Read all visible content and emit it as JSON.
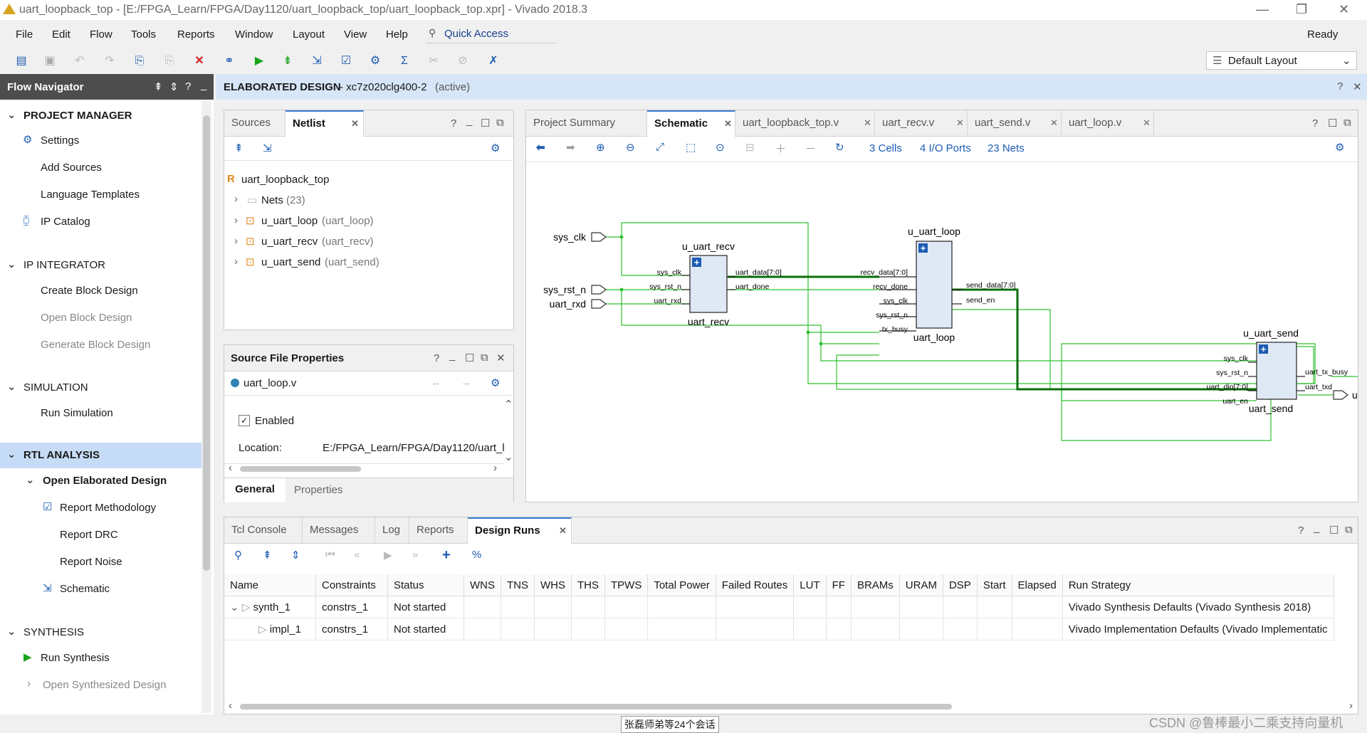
{
  "window": {
    "title": "uart_loopback_top - [E:/FPGA_Learn/FPGA/Day1120/uart_loopback_top/uart_loopback_top.xpr] - Vivado 2018.3",
    "minimize": "—",
    "restore": "❐",
    "close": "✕"
  },
  "menu": {
    "items": [
      "File",
      "Edit",
      "Flow",
      "Tools",
      "Reports",
      "Window",
      "Layout",
      "View",
      "Help"
    ],
    "quick_access": "Quick Access",
    "status": "Ready",
    "layout_select": "Default Layout"
  },
  "flow_nav": {
    "title": "Flow Navigator",
    "sections": [
      {
        "title": "PROJECT MANAGER",
        "items": [
          "Settings",
          "Add Sources",
          "Language Templates",
          "IP Catalog"
        ]
      },
      {
        "title": "IP INTEGRATOR",
        "items": [
          "Create Block Design",
          "Open Block Design",
          "Generate Block Design"
        ]
      },
      {
        "title": "SIMULATION",
        "items": [
          "Run Simulation"
        ]
      },
      {
        "title": "RTL ANALYSIS",
        "items": [
          "Open Elaborated Design",
          "Report Methodology",
          "Report DRC",
          "Report Noise",
          "Schematic"
        ]
      },
      {
        "title": "SYNTHESIS",
        "items": [
          "Run Synthesis",
          "Open Synthesized Design"
        ]
      }
    ]
  },
  "design_header": {
    "title": "ELABORATED DESIGN",
    "part": " - xc7z020clg400-2",
    "state": "(active)"
  },
  "sources_panel": {
    "tabs": [
      "Sources",
      "Netlist"
    ],
    "top": "uart_loopback_top",
    "nets": "Nets",
    "nets_count": "(23)",
    "cells": [
      {
        "name": "u_uart_loop",
        "type": "(uart_loop)"
      },
      {
        "name": "u_uart_recv",
        "type": "(uart_recv)"
      },
      {
        "name": "u_uart_send",
        "type": "(uart_send)"
      }
    ]
  },
  "props_panel": {
    "title": "Source File Properties",
    "file": "uart_loop.v",
    "enabled": "Enabled",
    "location_label": "Location:",
    "location_value": "E:/FPGA_Learn/FPGA/Day1120/uart_l",
    "tabs": [
      "General",
      "Properties"
    ]
  },
  "schematic_panel": {
    "tabs": [
      "Project Summary",
      "Schematic",
      "uart_loopback_top.v",
      "uart_recv.v",
      "uart_send.v",
      "uart_loop.v"
    ],
    "cells": "3 Cells",
    "ports": "4 I/O Ports",
    "nets": "23 Nets"
  },
  "schematic": {
    "inputs": [
      "sys_clk",
      "sys_rst_n",
      "uart_rxd"
    ],
    "outputs": [
      "uart_txd"
    ],
    "blocks": [
      {
        "name": "u_uart_recv",
        "type": "uart_recv",
        "in": [
          "sys_clk",
          "sys_rst_n",
          "uart_rxd"
        ],
        "out": [
          "uart_data[7:0]",
          "uart_done"
        ]
      },
      {
        "name": "u_uart_loop",
        "type": "uart_loop",
        "in": [
          "recv_data[7:0]",
          "recv_done",
          "sys_clk",
          "sys_rst_n",
          "tx_busy"
        ],
        "out": [
          "send_data[7:0]",
          "send_en"
        ]
      },
      {
        "name": "u_uart_send",
        "type": "uart_send",
        "in": [
          "sys_clk",
          "sys_rst_n",
          "uart_din[7:0]",
          "uart_en"
        ],
        "out": [
          "uart_tx_busy",
          "uart_txd"
        ]
      }
    ]
  },
  "bottom_panel": {
    "tabs": [
      "Tcl Console",
      "Messages",
      "Log",
      "Reports",
      "Design Runs"
    ],
    "columns": [
      "Name",
      "Constraints",
      "Status",
      "WNS",
      "TNS",
      "WHS",
      "THS",
      "TPWS",
      "Total Power",
      "Failed Routes",
      "LUT",
      "FF",
      "BRAMs",
      "URAM",
      "DSP",
      "Start",
      "Elapsed",
      "Run Strategy"
    ],
    "rows": [
      {
        "name": "synth_1",
        "constraints": "constrs_1",
        "status": "Not started",
        "strategy": "Vivado Synthesis Defaults (Vivado Synthesis 2018)"
      },
      {
        "name": "impl_1",
        "constraints": "constrs_1",
        "status": "Not started",
        "strategy": "Vivado Implementation Defaults (Vivado Implementatic"
      }
    ]
  },
  "statusbar": {
    "center": "张磊师弟等24个会话",
    "watermark": "CSDN @鲁棒最小二乘支持向量机"
  },
  "colors": {
    "accent": "#3c7fd1",
    "net": "#2ec02e",
    "bus": "#0a7a0a",
    "block": "#dfe9f5"
  }
}
